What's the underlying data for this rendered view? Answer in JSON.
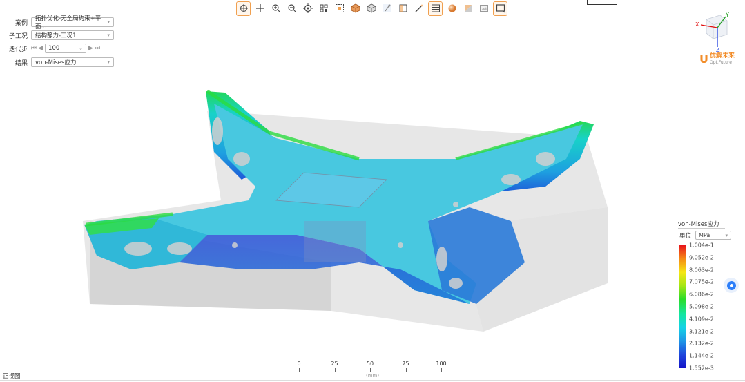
{
  "toolbar": {
    "buttons": [
      {
        "name": "rotate-icon",
        "active": true
      },
      {
        "name": "pan-icon",
        "active": false
      },
      {
        "name": "zoom-in-icon",
        "active": false
      },
      {
        "name": "zoom-out-icon",
        "active": false
      },
      {
        "name": "center-icon",
        "active": false
      },
      {
        "name": "fit-icon",
        "active": false
      },
      {
        "name": "region-zoom-icon",
        "active": false
      },
      {
        "name": "shaded-cube-icon",
        "active": false
      },
      {
        "name": "wireframe-cube-icon",
        "active": false
      },
      {
        "name": "probe-icon",
        "active": false
      },
      {
        "name": "section-icon",
        "active": false
      },
      {
        "name": "magic-icon",
        "active": false
      },
      {
        "name": "mesh-icon",
        "active": true
      },
      {
        "name": "sphere-icon",
        "active": false
      },
      {
        "name": "transparency-icon",
        "active": false
      },
      {
        "name": "image-icon",
        "active": false
      },
      {
        "name": "screen-icon",
        "active": true
      }
    ]
  },
  "params": {
    "case_label": "案例",
    "case_value": "拓扑优化-无全局约束+平面...",
    "subcase_label": "子工况",
    "subcase_value": "结构静力-工况1",
    "step_label": "迭代步",
    "step_value": "100",
    "result_label": "结果",
    "result_value": "von-Mises应力"
  },
  "triad": {
    "x": "X",
    "y": "Y",
    "z": "Z"
  },
  "logo": {
    "u": "U",
    "cn": "优解未来",
    "en": "Opt.Future"
  },
  "legend": {
    "title": "von-Mises应力",
    "unit_label": "单位",
    "unit_value": "MPa",
    "ticks": [
      "1.004e-1",
      "9.052e-2",
      "8.063e-2",
      "7.075e-2",
      "6.086e-2",
      "5.098e-2",
      "4.109e-2",
      "3.121e-2",
      "2.132e-2",
      "1.144e-2",
      "1.552e-3"
    ]
  },
  "scale": {
    "labels": [
      "0",
      "25",
      "50",
      "75",
      "100"
    ],
    "unit": "(mm)"
  },
  "bottom": {
    "left_text": "正视图"
  },
  "colors": {
    "accent": "#f0a050",
    "brand": "#f28c28"
  }
}
